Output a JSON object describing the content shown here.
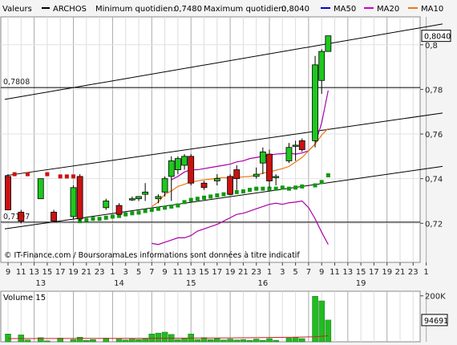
{
  "header": {
    "label": "Valeurs",
    "instrument": "ARCHOS",
    "min_label": "Minimum quotidien:",
    "min_value": "0,7480",
    "max_label": "Maximum quotidien:",
    "max_value": "0,8040",
    "ma_legend": [
      {
        "label": "MA50",
        "color": "#0000cc"
      },
      {
        "label": "MA20",
        "color": "#cc00cc"
      },
      {
        "label": "MA10",
        "color": "#ee7711"
      }
    ]
  },
  "watermark": "© IT-Finance.com / BoursoramaLes informations sont données à titre indicatif",
  "colors": {
    "up": "#1ec81e",
    "down": "#cc1111",
    "ma50": "#119911",
    "ma20": "#aa00aa",
    "ma10": "#ee7711",
    "bear_marker": "#cc1111",
    "volume": "#22bb22"
  },
  "chart_data": [
    {
      "type": "candlestick",
      "title": "ARCHOS",
      "ylim": [
        0.7025,
        0.8125
      ],
      "y_ticks": [
        {
          "v": 0.72,
          "label": "0,72"
        },
        {
          "v": 0.74,
          "label": "0,74"
        },
        {
          "v": 0.76,
          "label": "0,76"
        },
        {
          "v": 0.78,
          "label": "0,78"
        },
        {
          "v": 0.8,
          "label": "0,8"
        }
      ],
      "last_price": {
        "v": 0.804,
        "label": "0,8040"
      },
      "hlines": [
        {
          "v": 0.7808,
          "label": "0,7808"
        },
        {
          "v": 0.7205,
          "label": "0,7197"
        }
      ],
      "x_ticks": [
        {
          "i": 0,
          "label": "9"
        },
        {
          "i": 2,
          "label": "11"
        },
        {
          "i": 4,
          "label": "13"
        },
        {
          "i": 6,
          "label": "15"
        },
        {
          "i": 8,
          "label": "17"
        },
        {
          "i": 10,
          "label": "19"
        },
        {
          "i": 12,
          "label": "21"
        },
        {
          "i": 14,
          "label": "23"
        },
        {
          "i": 16,
          "label": "1"
        },
        {
          "i": 18,
          "label": "3"
        },
        {
          "i": 20,
          "label": "5"
        },
        {
          "i": 22,
          "label": "7"
        },
        {
          "i": 24,
          "label": "9"
        },
        {
          "i": 26,
          "label": "11"
        },
        {
          "i": 28,
          "label": "13"
        },
        {
          "i": 30,
          "label": "15"
        },
        {
          "i": 32,
          "label": "17"
        },
        {
          "i": 34,
          "label": "19"
        },
        {
          "i": 36,
          "label": "21"
        },
        {
          "i": 38,
          "label": "23"
        },
        {
          "i": 40,
          "label": "1"
        },
        {
          "i": 42,
          "label": "3"
        },
        {
          "i": 44,
          "label": "5"
        },
        {
          "i": 46,
          "label": "7"
        },
        {
          "i": 48,
          "label": "9"
        },
        {
          "i": 50,
          "label": "11"
        },
        {
          "i": 52,
          "label": "13"
        },
        {
          "i": 54,
          "label": "15"
        },
        {
          "i": 56,
          "label": "17"
        },
        {
          "i": 58,
          "label": "19"
        },
        {
          "i": 60,
          "label": "21"
        },
        {
          "i": 62,
          "label": "23"
        },
        {
          "i": 64,
          "label": "1"
        }
      ],
      "day_labels": [
        {
          "i": 5,
          "label": "13"
        },
        {
          "i": 17,
          "label": "14"
        },
        {
          "i": 28,
          "label": "15"
        },
        {
          "i": 39,
          "label": "16"
        },
        {
          "i": 54,
          "label": "19"
        }
      ],
      "candles": [
        {
          "i": 0,
          "o": 0.741,
          "h": 0.742,
          "l": 0.726,
          "c": 0.726
        },
        {
          "i": 2,
          "o": 0.725,
          "h": 0.726,
          "l": 0.72,
          "c": 0.721
        },
        {
          "i": 5,
          "o": 0.731,
          "h": 0.74,
          "l": 0.731,
          "c": 0.74
        },
        {
          "i": 7,
          "o": 0.725,
          "h": 0.726,
          "l": 0.721,
          "c": 0.721
        },
        {
          "i": 10,
          "o": 0.723,
          "h": 0.737,
          "l": 0.722,
          "c": 0.736
        },
        {
          "i": 11,
          "o": 0.741,
          "h": 0.742,
          "l": 0.721,
          "c": 0.722
        },
        {
          "i": 15,
          "o": 0.727,
          "h": 0.731,
          "l": 0.726,
          "c": 0.73
        },
        {
          "i": 17,
          "o": 0.728,
          "h": 0.729,
          "l": 0.724,
          "c": 0.724
        },
        {
          "i": 19,
          "o": 0.731,
          "h": 0.732,
          "l": 0.73,
          "c": 0.731
        },
        {
          "i": 20,
          "o": 0.731,
          "h": 0.732,
          "l": 0.73,
          "c": 0.732
        },
        {
          "i": 21,
          "o": 0.733,
          "h": 0.738,
          "l": 0.73,
          "c": 0.734
        },
        {
          "i": 23,
          "o": 0.731,
          "h": 0.733,
          "l": 0.729,
          "c": 0.732
        },
        {
          "i": 24,
          "o": 0.734,
          "h": 0.741,
          "l": 0.732,
          "c": 0.74
        },
        {
          "i": 25,
          "o": 0.741,
          "h": 0.75,
          "l": 0.73,
          "c": 0.748
        },
        {
          "i": 26,
          "o": 0.744,
          "h": 0.75,
          "l": 0.742,
          "c": 0.749
        },
        {
          "i": 27,
          "o": 0.746,
          "h": 0.751,
          "l": 0.744,
          "c": 0.75
        },
        {
          "i": 28,
          "o": 0.75,
          "h": 0.751,
          "l": 0.737,
          "c": 0.738
        },
        {
          "i": 30,
          "o": 0.738,
          "h": 0.739,
          "l": 0.735,
          "c": 0.736
        },
        {
          "i": 32,
          "o": 0.739,
          "h": 0.742,
          "l": 0.737,
          "c": 0.74
        },
        {
          "i": 34,
          "o": 0.741,
          "h": 0.742,
          "l": 0.733,
          "c": 0.733
        },
        {
          "i": 35,
          "o": 0.744,
          "h": 0.746,
          "l": 0.735,
          "c": 0.74
        },
        {
          "i": 38,
          "o": 0.741,
          "h": 0.745,
          "l": 0.74,
          "c": 0.742
        },
        {
          "i": 39,
          "o": 0.747,
          "h": 0.754,
          "l": 0.742,
          "c": 0.752
        },
        {
          "i": 40,
          "o": 0.751,
          "h": 0.753,
          "l": 0.736,
          "c": 0.739
        },
        {
          "i": 41,
          "o": 0.741,
          "h": 0.742,
          "l": 0.737,
          "c": 0.741
        },
        {
          "i": 43,
          "o": 0.748,
          "h": 0.756,
          "l": 0.747,
          "c": 0.754
        },
        {
          "i": 44,
          "o": 0.755,
          "h": 0.757,
          "l": 0.748,
          "c": 0.755
        },
        {
          "i": 45,
          "o": 0.757,
          "h": 0.758,
          "l": 0.752,
          "c": 0.753
        },
        {
          "i": 47,
          "o": 0.757,
          "h": 0.795,
          "l": 0.754,
          "c": 0.791
        },
        {
          "i": 48,
          "o": 0.784,
          "h": 0.798,
          "l": 0.778,
          "c": 0.797
        },
        {
          "i": 49,
          "o": 0.797,
          "h": 0.804,
          "l": 0.797,
          "c": 0.804
        }
      ],
      "bear_markers": [
        {
          "i": 1,
          "v": 0.742
        },
        {
          "i": 3,
          "v": 0.742
        },
        {
          "i": 6,
          "v": 0.742
        },
        {
          "i": 8,
          "v": 0.741
        },
        {
          "i": 9,
          "v": 0.741
        },
        {
          "i": 10,
          "v": 0.741
        }
      ],
      "ma50": [
        {
          "i": 11,
          "v": 0.721
        },
        {
          "i": 12,
          "v": 0.7215
        },
        {
          "i": 13,
          "v": 0.722
        },
        {
          "i": 14,
          "v": 0.722
        },
        {
          "i": 15,
          "v": 0.7225
        },
        {
          "i": 16,
          "v": 0.723
        },
        {
          "i": 17,
          "v": 0.7233
        },
        {
          "i": 18,
          "v": 0.724
        },
        {
          "i": 19,
          "v": 0.7245
        },
        {
          "i": 20,
          "v": 0.7248
        },
        {
          "i": 21,
          "v": 0.7255
        },
        {
          "i": 22,
          "v": 0.726
        },
        {
          "i": 23,
          "v": 0.7265
        },
        {
          "i": 24,
          "v": 0.727
        },
        {
          "i": 25,
          "v": 0.7275
        },
        {
          "i": 26,
          "v": 0.728
        },
        {
          "i": 27,
          "v": 0.7295
        },
        {
          "i": 28,
          "v": 0.7305
        },
        {
          "i": 29,
          "v": 0.731
        },
        {
          "i": 30,
          "v": 0.7315
        },
        {
          "i": 31,
          "v": 0.732
        },
        {
          "i": 32,
          "v": 0.7325
        },
        {
          "i": 33,
          "v": 0.733
        },
        {
          "i": 34,
          "v": 0.7335
        },
        {
          "i": 35,
          "v": 0.734
        },
        {
          "i": 36,
          "v": 0.7343
        },
        {
          "i": 37,
          "v": 0.735
        },
        {
          "i": 38,
          "v": 0.7355
        },
        {
          "i": 39,
          "v": 0.7355
        },
        {
          "i": 40,
          "v": 0.7355
        },
        {
          "i": 41,
          "v": 0.7355
        },
        {
          "i": 42,
          "v": 0.736
        },
        {
          "i": 43,
          "v": 0.7355
        },
        {
          "i": 44,
          "v": 0.736
        },
        {
          "i": 45,
          "v": 0.7365
        },
        {
          "i": 47,
          "v": 0.737
        },
        {
          "i": 48,
          "v": 0.7385
        },
        {
          "i": 49,
          "v": 0.7415
        }
      ],
      "ma20": [
        {
          "i": 22,
          "v": 0.711
        },
        {
          "i": 23,
          "v": 0.7105
        },
        {
          "i": 24,
          "v": 0.7115
        },
        {
          "i": 25,
          "v": 0.7125
        },
        {
          "i": 26,
          "v": 0.7135
        },
        {
          "i": 27,
          "v": 0.7135
        },
        {
          "i": 28,
          "v": 0.7145
        },
        {
          "i": 29,
          "v": 0.7165
        },
        {
          "i": 30,
          "v": 0.7175
        },
        {
          "i": 31,
          "v": 0.7185
        },
        {
          "i": 32,
          "v": 0.7195
        },
        {
          "i": 33,
          "v": 0.721
        },
        {
          "i": 34,
          "v": 0.7225
        },
        {
          "i": 35,
          "v": 0.724
        },
        {
          "i": 36,
          "v": 0.7245
        },
        {
          "i": 37,
          "v": 0.7255
        },
        {
          "i": 38,
          "v": 0.7265
        },
        {
          "i": 39,
          "v": 0.7275
        },
        {
          "i": 40,
          "v": 0.7285
        },
        {
          "i": 41,
          "v": 0.729
        },
        {
          "i": 42,
          "v": 0.7285
        },
        {
          "i": 43,
          "v": 0.7292
        },
        {
          "i": 44,
          "v": 0.7295
        },
        {
          "i": 45,
          "v": 0.73
        },
        {
          "i": 46,
          "v": 0.727
        },
        {
          "i": 47,
          "v": 0.722
        },
        {
          "i": 48,
          "v": 0.716
        },
        {
          "i": 49,
          "v": 0.7105
        }
      ],
      "ma20_upper": [
        {
          "i": 25,
          "v": 0.7395
        },
        {
          "i": 26,
          "v": 0.741
        },
        {
          "i": 27,
          "v": 0.743
        },
        {
          "i": 28,
          "v": 0.744
        },
        {
          "i": 29,
          "v": 0.744
        },
        {
          "i": 30,
          "v": 0.7445
        },
        {
          "i": 31,
          "v": 0.745
        },
        {
          "i": 32,
          "v": 0.7455
        },
        {
          "i": 33,
          "v": 0.746
        },
        {
          "i": 34,
          "v": 0.7465
        },
        {
          "i": 35,
          "v": 0.7475
        },
        {
          "i": 36,
          "v": 0.748
        },
        {
          "i": 37,
          "v": 0.749
        },
        {
          "i": 38,
          "v": 0.7495
        },
        {
          "i": 39,
          "v": 0.75
        },
        {
          "i": 40,
          "v": 0.7505
        },
        {
          "i": 41,
          "v": 0.751
        },
        {
          "i": 42,
          "v": 0.7512
        },
        {
          "i": 43,
          "v": 0.7515
        },
        {
          "i": 44,
          "v": 0.751
        },
        {
          "i": 45,
          "v": 0.7515
        },
        {
          "i": 46,
          "v": 0.7525
        },
        {
          "i": 47,
          "v": 0.7555
        },
        {
          "i": 48,
          "v": 0.765
        },
        {
          "i": 49,
          "v": 0.7795
        }
      ],
      "ma10": [
        {
          "i": 22,
          "v": 0.7275
        },
        {
          "i": 23,
          "v": 0.7295
        },
        {
          "i": 24,
          "v": 0.733
        },
        {
          "i": 25,
          "v": 0.7345
        },
        {
          "i": 26,
          "v": 0.7365
        },
        {
          "i": 27,
          "v": 0.7375
        },
        {
          "i": 28,
          "v": 0.7385
        },
        {
          "i": 29,
          "v": 0.739
        },
        {
          "i": 30,
          "v": 0.7395
        },
        {
          "i": 31,
          "v": 0.7398
        },
        {
          "i": 32,
          "v": 0.7402
        },
        {
          "i": 33,
          "v": 0.7405
        },
        {
          "i": 34,
          "v": 0.7402
        },
        {
          "i": 35,
          "v": 0.7405
        },
        {
          "i": 36,
          "v": 0.7408
        },
        {
          "i": 37,
          "v": 0.741
        },
        {
          "i": 38,
          "v": 0.7415
        },
        {
          "i": 39,
          "v": 0.7425
        },
        {
          "i": 40,
          "v": 0.743
        },
        {
          "i": 41,
          "v": 0.7438
        },
        {
          "i": 42,
          "v": 0.7445
        },
        {
          "i": 43,
          "v": 0.7455
        },
        {
          "i": 44,
          "v": 0.7475
        },
        {
          "i": 45,
          "v": 0.7495
        },
        {
          "i": 46,
          "v": 0.7525
        },
        {
          "i": 47,
          "v": 0.7555
        },
        {
          "i": 48,
          "v": 0.7595
        },
        {
          "i": 49,
          "v": 0.7625
        }
      ],
      "trendlines": [
        {
          "from": {
            "i": -0.5,
            "v": 0.7755
          },
          "to": {
            "i": 66.5,
            "v": 0.8093
          }
        },
        {
          "from": {
            "i": -0.5,
            "v": 0.7413
          },
          "to": {
            "i": 66.5,
            "v": 0.7694
          }
        },
        {
          "from": {
            "i": -0.5,
            "v": 0.7175
          },
          "to": {
            "i": 66.5,
            "v": 0.7455
          }
        }
      ]
    },
    {
      "type": "bar",
      "title": "Volume 15",
      "ylim": [
        0,
        220000
      ],
      "y_ticks": [
        {
          "v": 200000,
          "label": "200K"
        }
      ],
      "last_value": {
        "v": 94691,
        "label": "94691"
      },
      "ma_line": [
        {
          "i": 0,
          "v": 14000
        },
        {
          "i": 20,
          "v": 15000
        },
        {
          "i": 28,
          "v": 16000
        },
        {
          "i": 36,
          "v": 17500
        },
        {
          "i": 44,
          "v": 20000
        },
        {
          "i": 47,
          "v": 22000
        },
        {
          "i": 49,
          "v": 26000
        }
      ],
      "bars": [
        {
          "i": 0,
          "v": 34000
        },
        {
          "i": 2,
          "v": 30000
        },
        {
          "i": 3,
          "v": 8000
        },
        {
          "i": 5,
          "v": 18000
        },
        {
          "i": 6,
          "v": 4000
        },
        {
          "i": 8,
          "v": 16000
        },
        {
          "i": 10,
          "v": 10000
        },
        {
          "i": 11,
          "v": 20000
        },
        {
          "i": 12,
          "v": 6000
        },
        {
          "i": 13,
          "v": 10000
        },
        {
          "i": 15,
          "v": 16000
        },
        {
          "i": 17,
          "v": 12000
        },
        {
          "i": 18,
          "v": 8000
        },
        {
          "i": 19,
          "v": 12000
        },
        {
          "i": 20,
          "v": 10000
        },
        {
          "i": 21,
          "v": 14000
        },
        {
          "i": 22,
          "v": 34000
        },
        {
          "i": 23,
          "v": 38000
        },
        {
          "i": 24,
          "v": 42000
        },
        {
          "i": 25,
          "v": 32000
        },
        {
          "i": 26,
          "v": 10000
        },
        {
          "i": 27,
          "v": 16000
        },
        {
          "i": 28,
          "v": 34000
        },
        {
          "i": 29,
          "v": 10000
        },
        {
          "i": 30,
          "v": 18000
        },
        {
          "i": 31,
          "v": 10000
        },
        {
          "i": 32,
          "v": 14000
        },
        {
          "i": 33,
          "v": 8000
        },
        {
          "i": 34,
          "v": 12000
        },
        {
          "i": 35,
          "v": 8000
        },
        {
          "i": 36,
          "v": 10000
        },
        {
          "i": 37,
          "v": 6000
        },
        {
          "i": 38,
          "v": 12000
        },
        {
          "i": 39,
          "v": 6000
        },
        {
          "i": 40,
          "v": 14000
        },
        {
          "i": 41,
          "v": 6000
        },
        {
          "i": 43,
          "v": 16000
        },
        {
          "i": 44,
          "v": 20000
        },
        {
          "i": 45,
          "v": 14000
        },
        {
          "i": 47,
          "v": 198000
        },
        {
          "i": 48,
          "v": 178000
        },
        {
          "i": 49,
          "v": 94691
        }
      ]
    }
  ]
}
